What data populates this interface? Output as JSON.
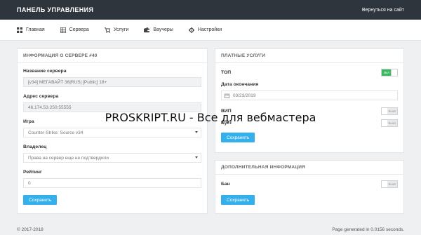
{
  "header": {
    "brand": "ПАНЕЛЬ УПРАВЛЕНИЯ",
    "back_link": "Вернуться на сайт"
  },
  "nav": {
    "items": [
      {
        "label": "Главная",
        "icon": "dashboard-icon"
      },
      {
        "label": "Сервера",
        "icon": "server-list-icon"
      },
      {
        "label": "Услуги",
        "icon": "cart-icon"
      },
      {
        "label": "Ваучеры",
        "icon": "wallet-icon"
      },
      {
        "label": "Настройки",
        "icon": "gear-icon"
      }
    ]
  },
  "server_info": {
    "title": "ИНФОРМАЦИЯ О СЕРВЕРЕ #40",
    "name_label": "Название сервера",
    "name_value": "[v34] МЕГАВАЙТ 36|RUS| [Public] 18+",
    "address_label": "Адрес сервера",
    "address_value": "46.174.53.250:55555",
    "game_label": "Игра",
    "game_value": "Counter-Strike: Source v34",
    "owner_label": "Владелец",
    "owner_value": "Права на сервер еще не подтвердили",
    "rating_label": "Рейтинг",
    "rating_value": "0",
    "save_label": "Сохранить"
  },
  "paid_services": {
    "title": "ПЛАТНЫЕ УСЛУГИ",
    "top_label": "ТОП",
    "top_toggle": "Вкл",
    "end_date_label": "Дата окончания",
    "end_date_value": "03/23/2019",
    "vip_label": "ВИП",
    "vip_toggle": "Выкл",
    "boost_label": "Буст",
    "boost_toggle": "Выкл",
    "save_label": "Сохранить"
  },
  "extra_info": {
    "title": "ДОПОЛНИТЕЛЬНАЯ ИНФОРМАЦИЯ",
    "ban_label": "Бан",
    "ban_toggle": "Выкл",
    "save_label": "Сохранить"
  },
  "watermark": "PROSKRIPT.RU - Все для вебмастера",
  "footer": {
    "copyright": "© 2017-2018",
    "generated": "Page generated in 0.0156 seconds."
  },
  "colors": {
    "topbar": "#2f353d",
    "accent": "#34b1ec",
    "toggle_on": "#3bb95f"
  }
}
